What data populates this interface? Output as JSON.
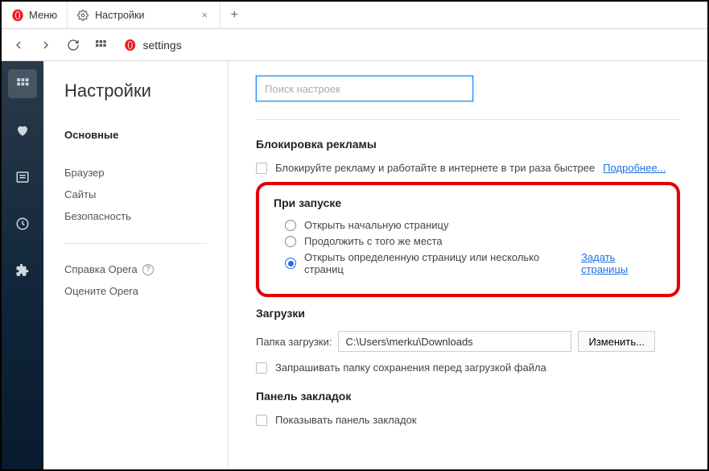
{
  "menu": {
    "label": "Меню"
  },
  "tab": {
    "title": "Настройки"
  },
  "address": {
    "value": "settings"
  },
  "sidebar": {
    "title": "Настройки",
    "items": [
      "Основные",
      "Браузер",
      "Сайты",
      "Безопасность"
    ],
    "help": "Справка Opera",
    "rate": "Оцените Opera"
  },
  "search": {
    "placeholder": "Поиск настроек"
  },
  "sections": {
    "adblock": {
      "title": "Блокировка рекламы",
      "checkbox_label": "Блокируйте рекламу и работайте в интернете в три раза быстрее",
      "more_link": "Подробнее..."
    },
    "startup": {
      "title": "При запуске",
      "opt1": "Открыть начальную страницу",
      "opt2": "Продолжить с того же места",
      "opt3": "Открыть определенную страницу или несколько страниц",
      "set_pages_link": "Задать страницы"
    },
    "downloads": {
      "title": "Загрузки",
      "folder_label": "Папка загрузки:",
      "folder_value": "C:\\Users\\merku\\Downloads",
      "change_btn": "Изменить...",
      "ask_label": "Запрашивать папку сохранения перед загрузкой файла"
    },
    "bookmarks_bar": {
      "title": "Панель закладок",
      "show_label": "Показывать панель закладок"
    }
  }
}
